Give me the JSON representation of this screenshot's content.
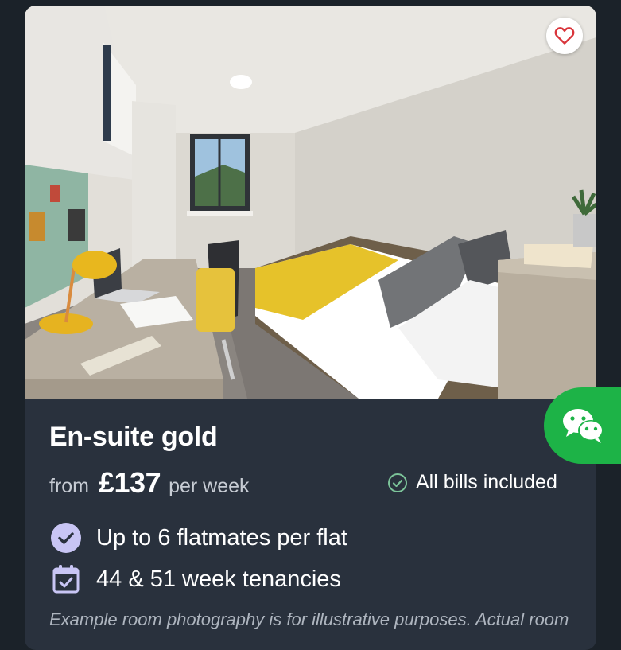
{
  "room": {
    "title": "En-suite gold",
    "price_prefix": "from",
    "price_amount": "£137",
    "price_suffix": "per week",
    "bills_label": "All bills included",
    "features": [
      {
        "icon": "check-badge-icon",
        "label": "Up to 6 flatmates per flat"
      },
      {
        "icon": "calendar-icon",
        "label": "44 & 51 week tenancies"
      }
    ],
    "disclaimer": "Example room photography is for illustrative purposes. Actual room"
  },
  "icons": {
    "favourite": "heart-icon",
    "chat": "wechat-icon",
    "bills": "check-circle-icon"
  },
  "colors": {
    "card_bg": "#29313d",
    "page_bg": "#1b2229",
    "accent_green": "#1db347",
    "bills_check": "#7cc49a",
    "feature_icon_bg": "#c8c5f4",
    "heart": "#d9353b"
  }
}
